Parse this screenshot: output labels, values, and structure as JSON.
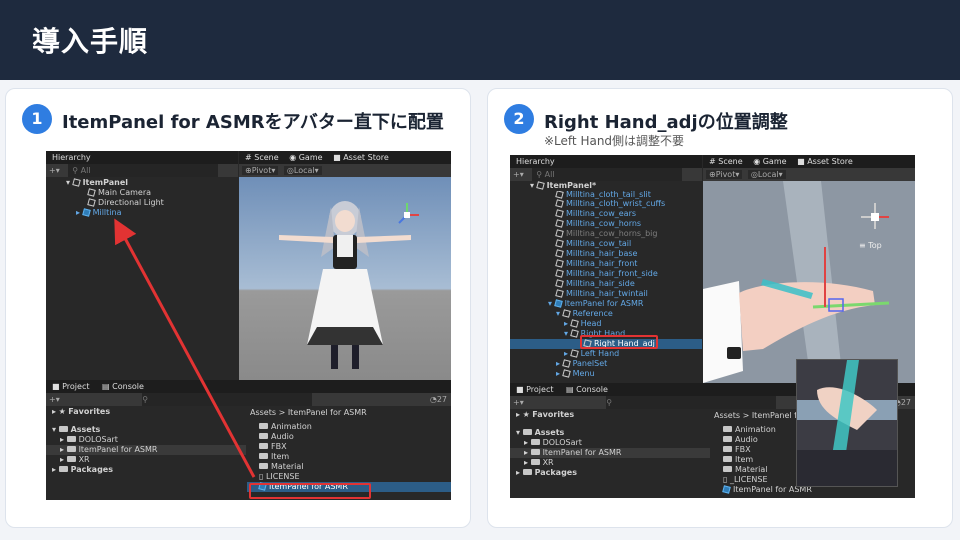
{
  "header": {
    "title": "導入手順"
  },
  "steps": [
    {
      "number": "1",
      "title": "ItemPanel for ASMRをアバター直下に配置",
      "hierarchy": {
        "tab": "Hierarchy",
        "search": "All",
        "items": [
          "ItemPanel",
          "Main Camera",
          "Directional Light",
          "Milltina"
        ]
      },
      "scene_tabs": {
        "scene": "Scene",
        "game": "Game",
        "store": "Asset Store"
      },
      "scene_tools": {
        "pivot": "Pivot",
        "local": "Local"
      },
      "project": {
        "tab_project": "Project",
        "tab_console": "Console",
        "hidden_count": "27",
        "favorites": "Favorites",
        "assets": "Assets",
        "asset_folders": [
          "DOLOSart",
          "ItemPanel for ASMR",
          "XR"
        ],
        "packages": "Packages",
        "breadcrumb": "Assets > ItemPanel for ASMR",
        "files": [
          "Animation",
          "Audio",
          "FBX",
          "Item",
          "Material",
          "LICENSE",
          "ItemPanel for ASMR"
        ]
      }
    },
    {
      "number": "2",
      "title": "Right Hand_adjの位置調整",
      "note": "※Left Hand側は調整不要",
      "hierarchy": {
        "tab": "Hierarchy",
        "search": "All",
        "root": "ItemPanel*",
        "items": [
          "Milltina_cloth_tail_slit",
          "Milltina_cloth_wrist_cuffs",
          "Milltina_cow_ears",
          "Milltina_cow_horns",
          "Milltina_cow_horns_big",
          "Milltina_cow_tail",
          "Milltina_hair_base",
          "Milltina_hair_front",
          "Milltina_hair_front_side",
          "Milltina_hair_side",
          "Milltina_hair_twintail",
          "ItemPanel for ASMR",
          "Reference",
          "Head",
          "Right Hand",
          "Right Hand_adj",
          "Left Hand",
          "PanelSet",
          "Menu"
        ]
      },
      "scene_tabs": {
        "scene": "Scene",
        "game": "Game",
        "store": "Asset Store"
      },
      "scene_tools": {
        "pivot": "Pivot",
        "local": "Local"
      },
      "gizmo_label": "Top",
      "project": {
        "tab_project": "Project",
        "tab_console": "Console",
        "hidden_count": "27",
        "favorites": "Favorites",
        "assets": "Assets",
        "asset_folders": [
          "DOLOSart",
          "ItemPanel for ASMR",
          "XR"
        ],
        "packages": "Packages",
        "breadcrumb": "Assets > ItemPanel for ASMR",
        "files": [
          "Animation",
          "Audio",
          "FBX",
          "Item",
          "Material",
          "_LICENSE",
          "ItemPanel for ASMR"
        ]
      }
    }
  ],
  "colors": {
    "header_bg": "#1e2a3e",
    "accent": "#2f7de1",
    "highlight": "#e23333",
    "selection": "#2c5d87"
  }
}
